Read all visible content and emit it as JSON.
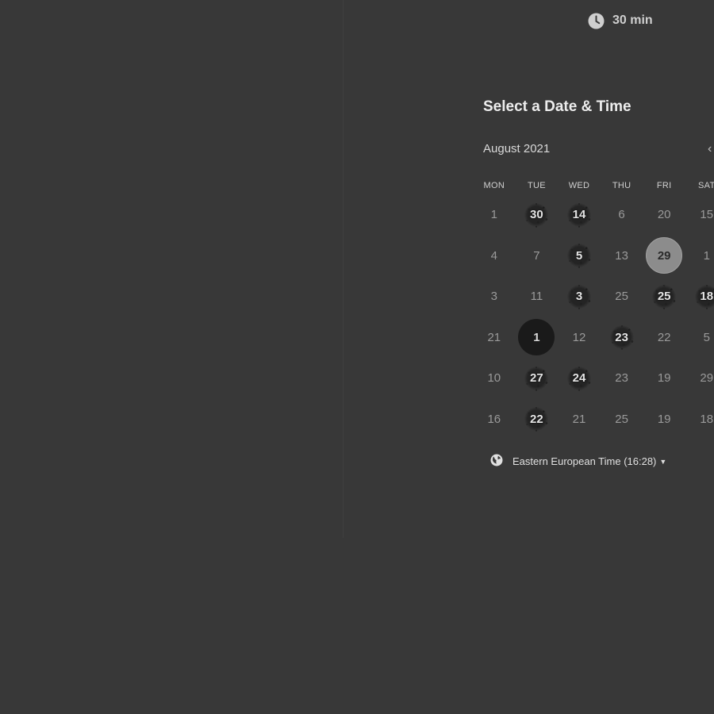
{
  "event": {
    "duration": "30 min",
    "icon": "clock-icon"
  },
  "heading": "Select a Date & Time",
  "calendar": {
    "month": "August 2021",
    "prev_icon": "chevron-left-icon",
    "weekdays": [
      "MON",
      "TUE",
      "WED",
      "THU",
      "FRI",
      "SAT"
    ],
    "rows": [
      [
        {
          "label": "1",
          "state": "unavailable"
        },
        {
          "label": "30",
          "state": "available"
        },
        {
          "label": "14",
          "state": "available"
        },
        {
          "label": "6",
          "state": "unavailable"
        },
        {
          "label": "20",
          "state": "unavailable"
        },
        {
          "label": "15",
          "state": "unavailable"
        }
      ],
      [
        {
          "label": "4",
          "state": "unavailable"
        },
        {
          "label": "7",
          "state": "unavailable"
        },
        {
          "label": "5",
          "state": "available"
        },
        {
          "label": "13",
          "state": "unavailable"
        },
        {
          "label": "29",
          "state": "today"
        },
        {
          "label": "1",
          "state": "unavailable"
        }
      ],
      [
        {
          "label": "3",
          "state": "unavailable"
        },
        {
          "label": "11",
          "state": "unavailable"
        },
        {
          "label": "3",
          "state": "available"
        },
        {
          "label": "25",
          "state": "unavailable"
        },
        {
          "label": "25",
          "state": "available"
        },
        {
          "label": "18",
          "state": "available"
        }
      ],
      [
        {
          "label": "21",
          "state": "unavailable"
        },
        {
          "label": "1",
          "state": "selected"
        },
        {
          "label": "12",
          "state": "unavailable"
        },
        {
          "label": "23",
          "state": "available"
        },
        {
          "label": "22",
          "state": "unavailable"
        },
        {
          "label": "5",
          "state": "unavailable"
        }
      ],
      [
        {
          "label": "10",
          "state": "unavailable"
        },
        {
          "label": "27",
          "state": "available"
        },
        {
          "label": "24",
          "state": "available"
        },
        {
          "label": "23",
          "state": "unavailable"
        },
        {
          "label": "19",
          "state": "unavailable"
        },
        {
          "label": "29",
          "state": "unavailable"
        }
      ],
      [
        {
          "label": "16",
          "state": "unavailable"
        },
        {
          "label": "22",
          "state": "available"
        },
        {
          "label": "21",
          "state": "unavailable"
        },
        {
          "label": "25",
          "state": "unavailable"
        },
        {
          "label": "19",
          "state": "unavailable"
        },
        {
          "label": "18",
          "state": "unavailable"
        }
      ]
    ]
  },
  "timezone": {
    "label": "Eastern European Time (16:28)",
    "icon": "globe-icon",
    "caret_icon": "caret-down-icon"
  },
  "colors": {
    "background": "#383838",
    "today_fill": "#8c8c8c",
    "selected_fill": "#1a1a1a"
  }
}
